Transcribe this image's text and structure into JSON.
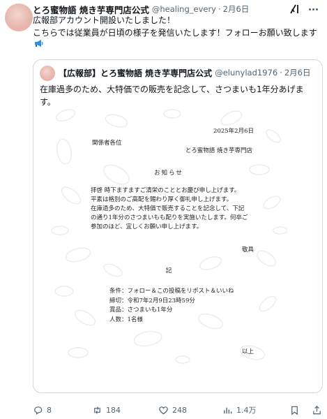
{
  "tweet": {
    "author_name": "とろ蜜物語 焼き芋専門店公式",
    "handle": "@healing_every",
    "separator": "·",
    "time": "2月6日",
    "text_lines": [
      "広報部アカウント開設いたしました！",
      "こちらでは従業員が日頃の様子を発信いたします！フォローお願い致します"
    ],
    "icons": {
      "grok": "grok-icon",
      "more": "more-icon",
      "megaphone": "megaphone-icon"
    }
  },
  "quote": {
    "author_name": "【広報部】とろ蜜物語 焼き芋専門店公式",
    "handle": "@elunylad1976",
    "separator": "·",
    "time": "2月6日",
    "text": "在庫過多のため、大特価での販売を記念して、さつまいも1年分あげます。",
    "notice": {
      "date": "2025年2月6日",
      "to": "関係者各位",
      "from": "とろ蜜物語 焼き芋専門店",
      "title": "お知らせ",
      "body_lines": [
        "拝啓 時下ますますご清栄のこととお慶び申し上げます。",
        "平素は格別のご高配を賜わり厚く御礼申し上げます。",
        "在庫過多のため、大特価で販売することを記念して、下記",
        "の通り1年分のさつまいもも配りを実施いたします。何卒ご",
        "参加のほど、宜しくお願い申し上げます。"
      ],
      "sign": "敬具",
      "ki": "記",
      "conditions": [
        "条件：フォロー＆この投稿をリポスト＆いいね",
        "締切：令和7年2月9日23時59分",
        "賞品：さつまいも1年分",
        "人数：1名様"
      ],
      "closing": "以上"
    }
  },
  "actions": {
    "replies": "8",
    "reposts": "184",
    "likes": "248",
    "views": "1.4万",
    "icons": [
      "reply-icon",
      "repost-icon",
      "like-icon",
      "views-icon",
      "bookmark-icon",
      "share-icon"
    ]
  },
  "colors": {
    "text": "#0f1419",
    "secondary": "#536471",
    "border": "#cfd9de",
    "avatar": "#e8b7ad"
  }
}
